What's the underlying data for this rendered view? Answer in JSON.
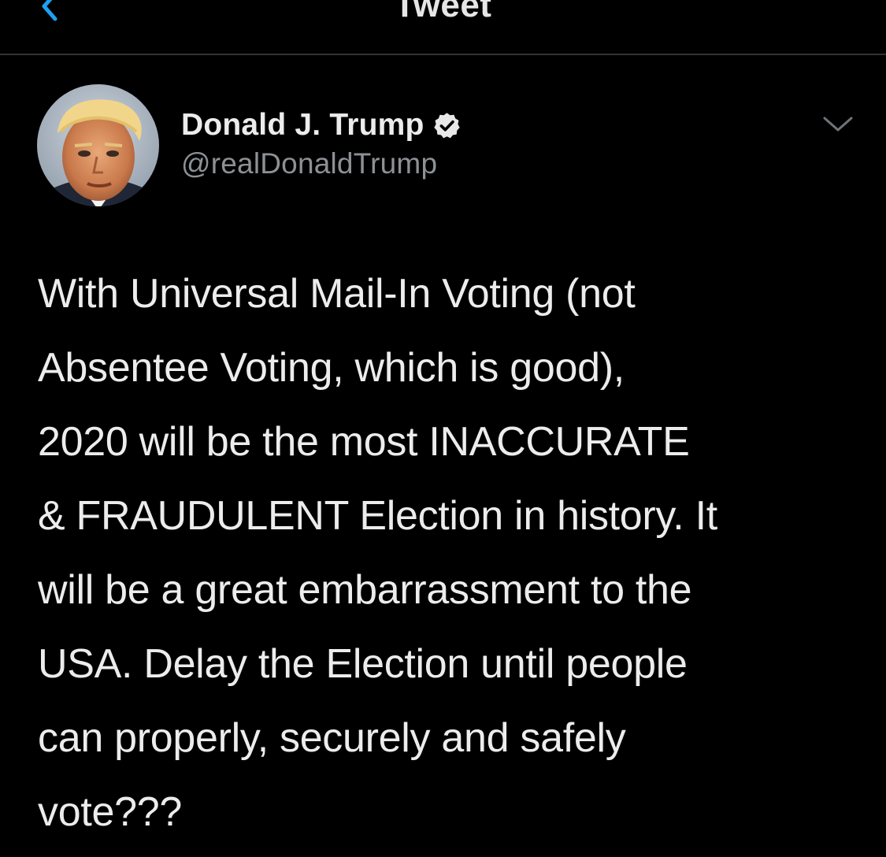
{
  "header": {
    "title": "Tweet",
    "back_icon": "chevron-left-icon",
    "accent_color": "#1da1f2"
  },
  "tweet": {
    "author": {
      "display_name": "Donald J. Trump",
      "handle": "@realDonaldTrump",
      "verified": true,
      "verified_icon": "verified-badge-icon"
    },
    "more_icon": "chevron-down-icon",
    "text_lines": [
      "With Universal Mail-In Voting (not",
      "Absentee Voting, which is good),",
      "2020 will be the most INACCURATE",
      "& FRAUDULENT Election in history. It",
      "will be a great embarrassment to the",
      "USA. Delay the Election until people",
      "can properly, securely and safely",
      "vote???"
    ]
  },
  "colors": {
    "background": "#000000",
    "primary_text": "#ececec",
    "secondary_text": "#8d9196",
    "divider": "#2f3336"
  }
}
